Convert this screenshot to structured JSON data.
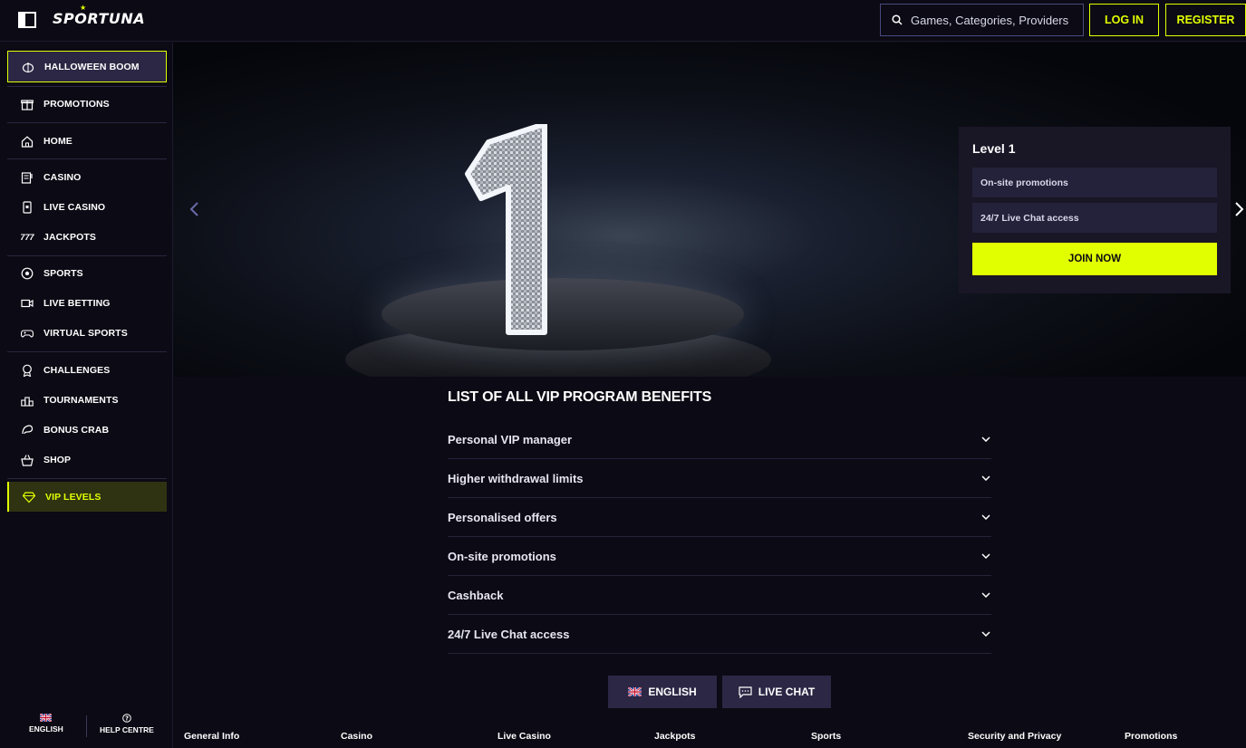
{
  "header": {
    "logo": "SPORTUNA",
    "search_placeholder": "Games, Categories, Providers",
    "login_label": "LOG IN",
    "register_label": "REGISTER"
  },
  "sidebar": {
    "items": [
      {
        "label": "HALLOWEEN BOOM",
        "icon": "pumpkin-icon"
      },
      {
        "label": "PROMOTIONS",
        "icon": "gift-icon"
      },
      {
        "label": "HOME",
        "icon": "home-icon"
      },
      {
        "label": "CASINO",
        "icon": "slot-icon"
      },
      {
        "label": "LIVE CASINO",
        "icon": "card-icon"
      },
      {
        "label": "JACKPOTS",
        "icon": "777-icon"
      },
      {
        "label": "SPORTS",
        "icon": "ball-icon"
      },
      {
        "label": "LIVE BETTING",
        "icon": "video-icon"
      },
      {
        "label": "VIRTUAL SPORTS",
        "icon": "gamepad-icon"
      },
      {
        "label": "CHALLENGES",
        "icon": "medal-icon"
      },
      {
        "label": "TOURNAMENTS",
        "icon": "podium-icon"
      },
      {
        "label": "BONUS CRAB",
        "icon": "crab-icon"
      },
      {
        "label": "SHOP",
        "icon": "basket-icon"
      },
      {
        "label": "VIP LEVELS",
        "icon": "diamond-icon"
      }
    ],
    "language_label": "ENGLISH",
    "help_label": "HELP CENTRE"
  },
  "hero": {
    "level_title": "Level 1",
    "level_rows": [
      "On-site promotions",
      "24/7 Live Chat access"
    ],
    "join_label": "JOIN NOW"
  },
  "benefits": {
    "title": "LIST OF ALL VIP PROGRAM BENEFITS",
    "items": [
      "Personal VIP manager",
      "Higher withdrawal limits",
      "Personalised offers",
      "On-site promotions",
      "Cashback",
      "24/7 Live Chat access"
    ]
  },
  "bottom_buttons": {
    "language": "ENGLISH",
    "live_chat": "LIVE CHAT"
  },
  "footer": {
    "columns": [
      "General Info",
      "Casino",
      "Live Casino",
      "Jackpots",
      "Sports",
      "Security and Privacy",
      "Promotions"
    ]
  },
  "colors": {
    "accent": "#e2ff00",
    "background": "#0c0a14",
    "panel": "#2b2744"
  }
}
